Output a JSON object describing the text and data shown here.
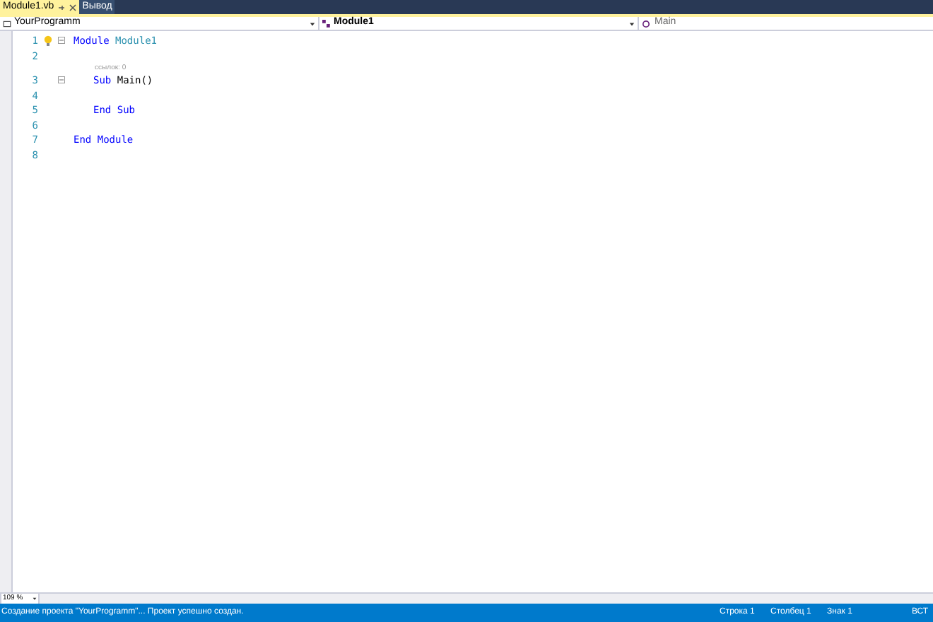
{
  "tabs": [
    {
      "label": "Module1.vb",
      "selected": true,
      "pinned": true
    },
    {
      "label": "Вывод",
      "selected": false,
      "pinned": false
    }
  ],
  "nav": {
    "project": "YourProgramm",
    "type": "Module1",
    "member": "Main"
  },
  "lines": [
    {
      "number": "1",
      "lightbulb": true,
      "fold": true,
      "tokens": [
        {
          "kind": "keyword",
          "text": "Module"
        },
        {
          "kind": "type",
          "text": "Module1"
        }
      ],
      "children": [
        {
          "number": "2",
          "lightbulb": false,
          "fold": false
        },
        {
          "number": "3",
          "lightbulb": false,
          "fold": true,
          "codelens": "ссылок: 0",
          "tokens": [
            {
              "kind": "keyword",
              "text": "Sub"
            },
            {
              "kind": "plain",
              "text": "Main()"
            }
          ],
          "children": [
            {
              "number": "4",
              "lightbulb": false,
              "fold": false
            }
          ]
        },
        {
          "number": "5",
          "lightbulb": false,
          "fold": false,
          "tokens": [
            {
              "kind": "keyword",
              "text": "End Sub"
            }
          ]
        },
        {
          "number": "6",
          "lightbulb": false,
          "fold": false
        }
      ]
    },
    {
      "number": "7",
      "lightbulb": false,
      "fold": false,
      "tokens": [
        {
          "kind": "keyword",
          "text": "End Module"
        }
      ]
    },
    {
      "number": "8",
      "lightbulb": false,
      "fold": false
    }
  ],
  "zoom": "109 %",
  "status_bar": {
    "message": "Создание проекта \"YourProgramm\"... Проект успешно создан.",
    "row": "Строка 1",
    "column": "Столбец 1",
    "char": "Знак 1",
    "mode": "ВСТ"
  }
}
